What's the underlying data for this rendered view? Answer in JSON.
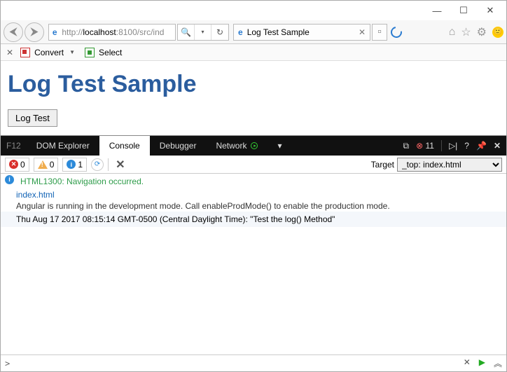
{
  "window": {
    "min": "—",
    "max": "☐",
    "close": "✕"
  },
  "nav": {
    "url_prefix": "http://",
    "url_host": "localhost",
    "url_rest": ":8100/src/ind",
    "tab_title": "Log Test Sample",
    "convert": "Convert",
    "select": "Select"
  },
  "page": {
    "heading": "Log Test Sample",
    "button": "Log Test"
  },
  "devtools": {
    "f12": "F12",
    "tabs": {
      "dom": "DOM Explorer",
      "console": "Console",
      "debugger": "Debugger",
      "network": "Network"
    },
    "err_count": "11",
    "counts": {
      "errors": "0",
      "warnings": "0",
      "info": "1"
    },
    "target_label": "Target",
    "target_value": "_top: index.html"
  },
  "console": {
    "line1_code": "HTML1300",
    "line1_msg": "Navigation occurred.",
    "line2": "index.html",
    "line3": "Angular is running in the development mode. Call enableProdMode() to enable the production mode.",
    "line4": "Thu Aug 17 2017 08:15:14 GMT-0500 (Central Daylight Time): \"Test the log() Method\""
  },
  "input": {
    "prompt": ">"
  }
}
